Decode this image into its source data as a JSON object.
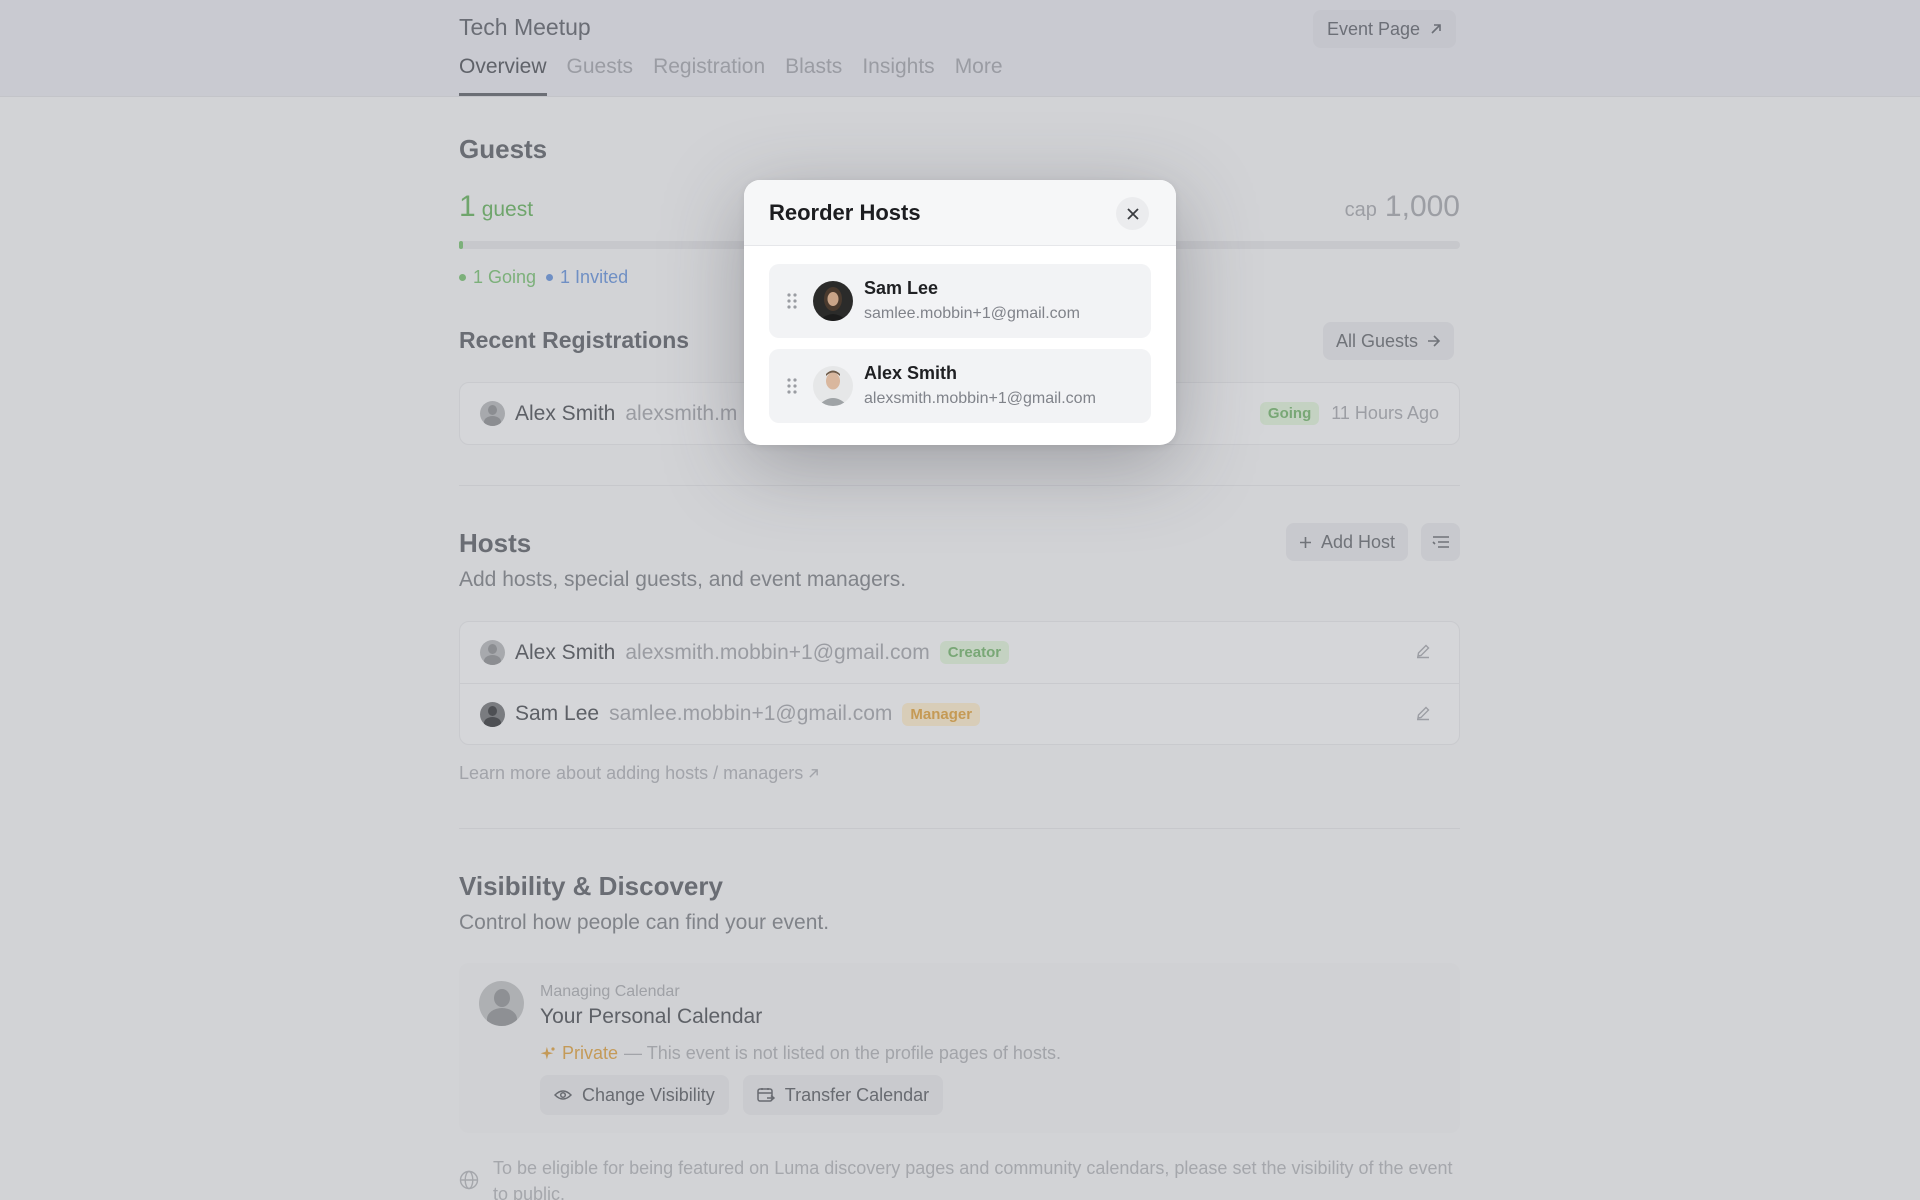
{
  "header": {
    "event_title": "Tech Meetup",
    "event_page_label": "Event Page",
    "tabs": [
      "Overview",
      "Guests",
      "Registration",
      "Blasts",
      "Insights",
      "More"
    ],
    "active_tab": "Overview"
  },
  "guests": {
    "heading": "Guests",
    "count": "1",
    "count_unit": "guest",
    "cap_label": "cap",
    "cap_value": "1,000",
    "progress_fraction": 0.001,
    "going_label": "1 Going",
    "invited_label": "1 Invited",
    "going_color": "#7cb07a",
    "invited_color": "#6f8fc4"
  },
  "recent": {
    "heading": "Recent Registrations",
    "all_guests_label": "All Guests",
    "rows": [
      {
        "name": "Alex Smith",
        "email": "alexsmith.m",
        "status": "Going",
        "time": "11 Hours Ago"
      }
    ]
  },
  "hosts": {
    "heading": "Hosts",
    "subtitle": "Add hosts, special guests, and event managers.",
    "add_host_label": "Add Host",
    "rows": [
      {
        "name": "Alex Smith",
        "email": "alexsmith.mobbin+1@gmail.com",
        "role": "Creator"
      },
      {
        "name": "Sam Lee",
        "email": "samlee.mobbin+1@gmail.com",
        "role": "Manager"
      }
    ],
    "learn_more": "Learn more about adding hosts / managers"
  },
  "visibility": {
    "heading": "Visibility & Discovery",
    "subtitle": "Control how people can find your event.",
    "managing_label": "Managing Calendar",
    "calendar_name": "Your Personal Calendar",
    "private_label": "Private",
    "private_desc": "— This event is not listed on the profile pages of hosts.",
    "change_visibility_label": "Change Visibility",
    "transfer_calendar_label": "Transfer Calendar",
    "discover_note": "To be eligible for being featured on Luma discovery pages and community calendars, please set the visibility of the event to public."
  },
  "modal": {
    "title": "Reorder Hosts",
    "hosts": [
      {
        "name": "Sam Lee",
        "email": "samlee.mobbin+1@gmail.com"
      },
      {
        "name": "Alex Smith",
        "email": "alexsmith.mobbin+1@gmail.com"
      }
    ]
  }
}
